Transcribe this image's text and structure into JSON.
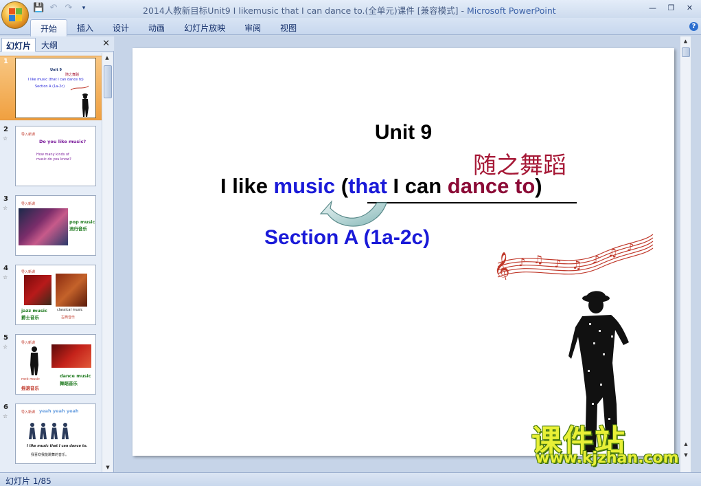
{
  "window": {
    "title_doc": "2014人教新目标Unit9 I likemusic that I can dance to.(全单元)课件 [兼容模式]",
    "title_sep": " - ",
    "title_app": "Microsoft PowerPoint"
  },
  "ribbon": {
    "tabs": [
      "开始",
      "插入",
      "设计",
      "动画",
      "幻灯片放映",
      "审阅",
      "视图"
    ],
    "active_tab": "开始"
  },
  "left_pane": {
    "tab_slides": "幻灯片",
    "tab_outline": "大纲",
    "thumbnails": [
      {
        "num": "1",
        "selected": true,
        "texts": [
          "Unit 9",
          "随之舞蹈",
          "I like music (that I can dance to)",
          "Section A (1a-2c)"
        ]
      },
      {
        "num": "2",
        "texts": [
          "导入新课",
          "Do you like music?",
          "How many kinds of",
          "music do you know?"
        ]
      },
      {
        "num": "3",
        "texts": [
          "导入新课",
          "pop music",
          "流行音乐"
        ]
      },
      {
        "num": "4",
        "texts": [
          "导入新课",
          "jazz music",
          "爵士音乐",
          "classical music",
          "古典音乐"
        ]
      },
      {
        "num": "5",
        "texts": [
          "导入新课",
          "rock music",
          "摇滚音乐",
          "dance music",
          "舞蹈音乐"
        ]
      },
      {
        "num": "6",
        "texts": [
          "导入新课",
          "yeah yeah yeah",
          "I like music that I can dance to.",
          "我喜欢我能跳舞的音乐。"
        ]
      }
    ]
  },
  "slide": {
    "unit": "Unit 9",
    "chinese_title": "随之舞蹈",
    "line_parts": {
      "p1": "I like ",
      "p2": "music",
      "p3": " (",
      "p4": "that",
      "p5": " I can ",
      "p6": "dance to",
      "p7": ")"
    },
    "section": "Section A (1a-2c)"
  },
  "status": {
    "slide_info": "幻灯片 1/85"
  },
  "watermark": {
    "cn": "课件站",
    "url": "www.kjzhan.com"
  },
  "colors": {
    "blue_text": "#1a1ad8",
    "red_text": "#8b0a36",
    "chinese_title": "#a61836",
    "selected_thumb": "#f0a040"
  }
}
